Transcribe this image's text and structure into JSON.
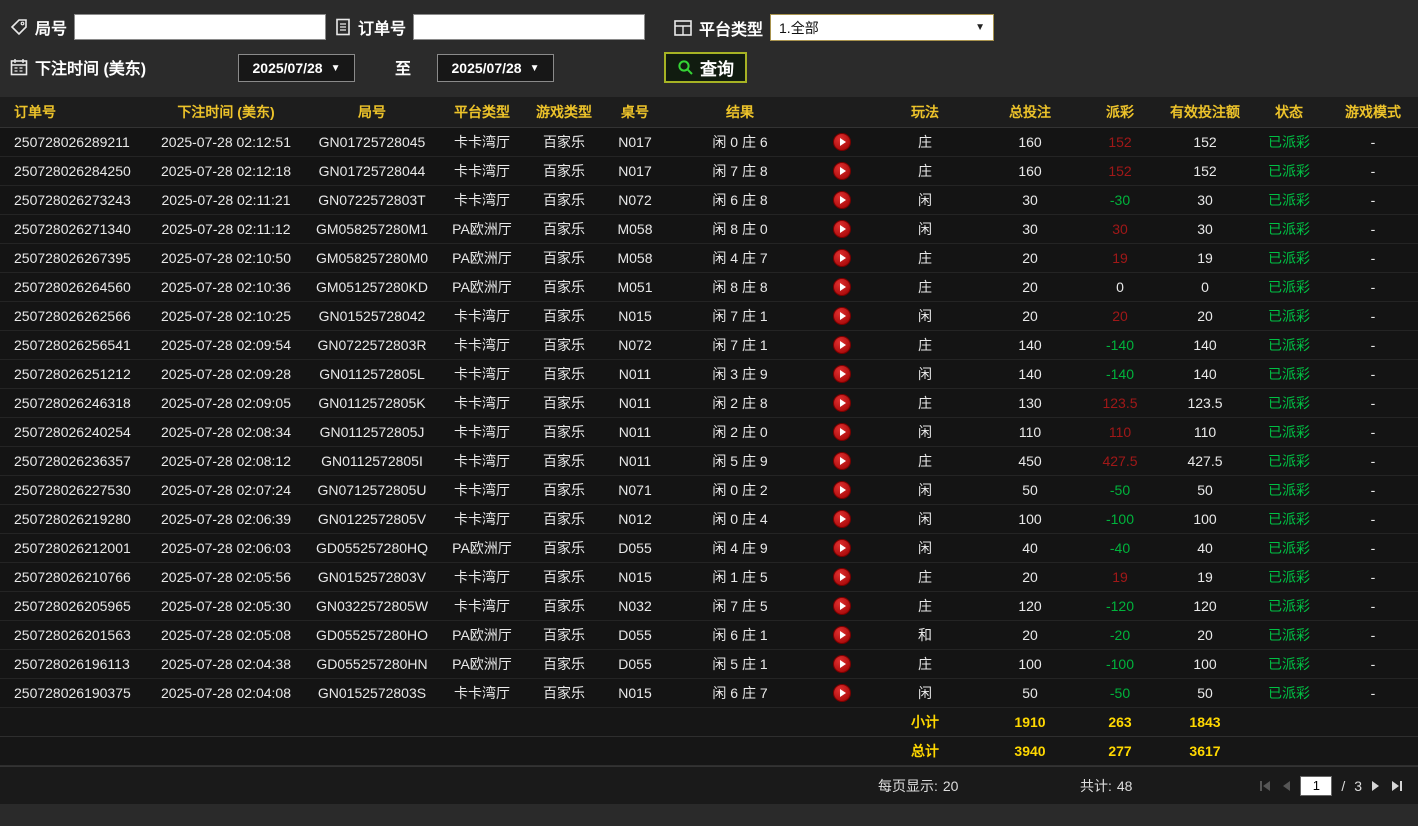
{
  "filters": {
    "round": {
      "label": "局号",
      "value": "",
      "placeholder": ""
    },
    "order": {
      "label": "订单号",
      "value": "",
      "placeholder": ""
    },
    "platform": {
      "label": "平台类型",
      "selected": "1.全部"
    },
    "bet_time": {
      "label": "下注时间 (美东)",
      "from": "2025/07/28",
      "to_label": "至",
      "to": "2025/07/28"
    },
    "query_label": "查询"
  },
  "table": {
    "headers": [
      "订单号",
      "下注时间 (美东)",
      "局号",
      "平台类型",
      "游戏类型",
      "桌号",
      "结果",
      "",
      "玩法",
      "总投注",
      "派彩",
      "有效投注额",
      "状态",
      "游戏模式"
    ],
    "rows": [
      {
        "order_id": "250728026289211",
        "bet_time": "2025-07-28 02:12:51",
        "round_id": "GN01725728045",
        "platform": "卡卡湾厅",
        "game_type": "百家乐",
        "table_no": "N017",
        "result": "闲 0 庄 6",
        "play": "庄",
        "total_bet": "160",
        "payout": "152",
        "valid_bet": "152",
        "status": "已派彩",
        "mode": "-"
      },
      {
        "order_id": "250728026284250",
        "bet_time": "2025-07-28 02:12:18",
        "round_id": "GN01725728044",
        "platform": "卡卡湾厅",
        "game_type": "百家乐",
        "table_no": "N017",
        "result": "闲 7 庄 8",
        "play": "庄",
        "total_bet": "160",
        "payout": "152",
        "valid_bet": "152",
        "status": "已派彩",
        "mode": "-"
      },
      {
        "order_id": "250728026273243",
        "bet_time": "2025-07-28 02:11:21",
        "round_id": "GN0722572803T",
        "platform": "卡卡湾厅",
        "game_type": "百家乐",
        "table_no": "N072",
        "result": "闲 6 庄 8",
        "play": "闲",
        "total_bet": "30",
        "payout": "-30",
        "valid_bet": "30",
        "status": "已派彩",
        "mode": "-"
      },
      {
        "order_id": "250728026271340",
        "bet_time": "2025-07-28 02:11:12",
        "round_id": "GM058257280M1",
        "platform": "PA欧洲厅",
        "game_type": "百家乐",
        "table_no": "M058",
        "result": "闲 8 庄 0",
        "play": "闲",
        "total_bet": "30",
        "payout": "30",
        "valid_bet": "30",
        "status": "已派彩",
        "mode": "-"
      },
      {
        "order_id": "250728026267395",
        "bet_time": "2025-07-28 02:10:50",
        "round_id": "GM058257280M0",
        "platform": "PA欧洲厅",
        "game_type": "百家乐",
        "table_no": "M058",
        "result": "闲 4 庄 7",
        "play": "庄",
        "total_bet": "20",
        "payout": "19",
        "valid_bet": "19",
        "status": "已派彩",
        "mode": "-"
      },
      {
        "order_id": "250728026264560",
        "bet_time": "2025-07-28 02:10:36",
        "round_id": "GM051257280KD",
        "platform": "PA欧洲厅",
        "game_type": "百家乐",
        "table_no": "M051",
        "result": "闲 8 庄 8",
        "play": "庄",
        "total_bet": "20",
        "payout": "0",
        "valid_bet": "0",
        "status": "已派彩",
        "mode": "-"
      },
      {
        "order_id": "250728026262566",
        "bet_time": "2025-07-28 02:10:25",
        "round_id": "GN01525728042",
        "platform": "卡卡湾厅",
        "game_type": "百家乐",
        "table_no": "N015",
        "result": "闲 7 庄 1",
        "play": "闲",
        "total_bet": "20",
        "payout": "20",
        "valid_bet": "20",
        "status": "已派彩",
        "mode": "-"
      },
      {
        "order_id": "250728026256541",
        "bet_time": "2025-07-28 02:09:54",
        "round_id": "GN0722572803R",
        "platform": "卡卡湾厅",
        "game_type": "百家乐",
        "table_no": "N072",
        "result": "闲 7 庄 1",
        "play": "庄",
        "total_bet": "140",
        "payout": "-140",
        "valid_bet": "140",
        "status": "已派彩",
        "mode": "-"
      },
      {
        "order_id": "250728026251212",
        "bet_time": "2025-07-28 02:09:28",
        "round_id": "GN0112572805L",
        "platform": "卡卡湾厅",
        "game_type": "百家乐",
        "table_no": "N011",
        "result": "闲 3 庄 9",
        "play": "闲",
        "total_bet": "140",
        "payout": "-140",
        "valid_bet": "140",
        "status": "已派彩",
        "mode": "-"
      },
      {
        "order_id": "250728026246318",
        "bet_time": "2025-07-28 02:09:05",
        "round_id": "GN0112572805K",
        "platform": "卡卡湾厅",
        "game_type": "百家乐",
        "table_no": "N011",
        "result": "闲 2 庄 8",
        "play": "庄",
        "total_bet": "130",
        "payout": "123.5",
        "valid_bet": "123.5",
        "status": "已派彩",
        "mode": "-"
      },
      {
        "order_id": "250728026240254",
        "bet_time": "2025-07-28 02:08:34",
        "round_id": "GN0112572805J",
        "platform": "卡卡湾厅",
        "game_type": "百家乐",
        "table_no": "N011",
        "result": "闲 2 庄 0",
        "play": "闲",
        "total_bet": "110",
        "payout": "110",
        "valid_bet": "110",
        "status": "已派彩",
        "mode": "-"
      },
      {
        "order_id": "250728026236357",
        "bet_time": "2025-07-28 02:08:12",
        "round_id": "GN0112572805I",
        "platform": "卡卡湾厅",
        "game_type": "百家乐",
        "table_no": "N011",
        "result": "闲 5 庄 9",
        "play": "庄",
        "total_bet": "450",
        "payout": "427.5",
        "valid_bet": "427.5",
        "status": "已派彩",
        "mode": "-"
      },
      {
        "order_id": "250728026227530",
        "bet_time": "2025-07-28 02:07:24",
        "round_id": "GN0712572805U",
        "platform": "卡卡湾厅",
        "game_type": "百家乐",
        "table_no": "N071",
        "result": "闲 0 庄 2",
        "play": "闲",
        "total_bet": "50",
        "payout": "-50",
        "valid_bet": "50",
        "status": "已派彩",
        "mode": "-"
      },
      {
        "order_id": "250728026219280",
        "bet_time": "2025-07-28 02:06:39",
        "round_id": "GN0122572805V",
        "platform": "卡卡湾厅",
        "game_type": "百家乐",
        "table_no": "N012",
        "result": "闲 0 庄 4",
        "play": "闲",
        "total_bet": "100",
        "payout": "-100",
        "valid_bet": "100",
        "status": "已派彩",
        "mode": "-"
      },
      {
        "order_id": "250728026212001",
        "bet_time": "2025-07-28 02:06:03",
        "round_id": "GD055257280HQ",
        "platform": "PA欧洲厅",
        "game_type": "百家乐",
        "table_no": "D055",
        "result": "闲 4 庄 9",
        "play": "闲",
        "total_bet": "40",
        "payout": "-40",
        "valid_bet": "40",
        "status": "已派彩",
        "mode": "-"
      },
      {
        "order_id": "250728026210766",
        "bet_time": "2025-07-28 02:05:56",
        "round_id": "GN0152572803V",
        "platform": "卡卡湾厅",
        "game_type": "百家乐",
        "table_no": "N015",
        "result": "闲 1 庄 5",
        "play": "庄",
        "total_bet": "20",
        "payout": "19",
        "valid_bet": "19",
        "status": "已派彩",
        "mode": "-"
      },
      {
        "order_id": "250728026205965",
        "bet_time": "2025-07-28 02:05:30",
        "round_id": "GN0322572805W",
        "platform": "卡卡湾厅",
        "game_type": "百家乐",
        "table_no": "N032",
        "result": "闲 7 庄 5",
        "play": "庄",
        "total_bet": "120",
        "payout": "-120",
        "valid_bet": "120",
        "status": "已派彩",
        "mode": "-"
      },
      {
        "order_id": "250728026201563",
        "bet_time": "2025-07-28 02:05:08",
        "round_id": "GD055257280HO",
        "platform": "PA欧洲厅",
        "game_type": "百家乐",
        "table_no": "D055",
        "result": "闲 6 庄 1",
        "play": "和",
        "total_bet": "20",
        "payout": "-20",
        "valid_bet": "20",
        "status": "已派彩",
        "mode": "-"
      },
      {
        "order_id": "250728026196113",
        "bet_time": "2025-07-28 02:04:38",
        "round_id": "GD055257280HN",
        "platform": "PA欧洲厅",
        "game_type": "百家乐",
        "table_no": "D055",
        "result": "闲 5 庄 1",
        "play": "庄",
        "total_bet": "100",
        "payout": "-100",
        "valid_bet": "100",
        "status": "已派彩",
        "mode": "-"
      },
      {
        "order_id": "250728026190375",
        "bet_time": "2025-07-28 02:04:08",
        "round_id": "GN0152572803S",
        "platform": "卡卡湾厅",
        "game_type": "百家乐",
        "table_no": "N015",
        "result": "闲 6 庄 7",
        "play": "闲",
        "total_bet": "50",
        "payout": "-50",
        "valid_bet": "50",
        "status": "已派彩",
        "mode": "-"
      }
    ]
  },
  "summary": {
    "subtotal": {
      "label": "小计",
      "total_bet": "1910",
      "payout": "263",
      "valid_bet": "1843"
    },
    "total": {
      "label": "总计",
      "total_bet": "3940",
      "payout": "277",
      "valid_bet": "3617"
    }
  },
  "pagination": {
    "per_page_label": "每页显示:",
    "per_page_value": "20",
    "total_label": "共计:",
    "total_value": "48",
    "page_input": "1",
    "page_separator": "/",
    "total_pages": "3"
  },
  "colors": {
    "header_text": "#edc32a",
    "win": "#a01818",
    "loss": "#00b33c",
    "status_paid": "#00c044",
    "summary_text": "#ffd800"
  }
}
